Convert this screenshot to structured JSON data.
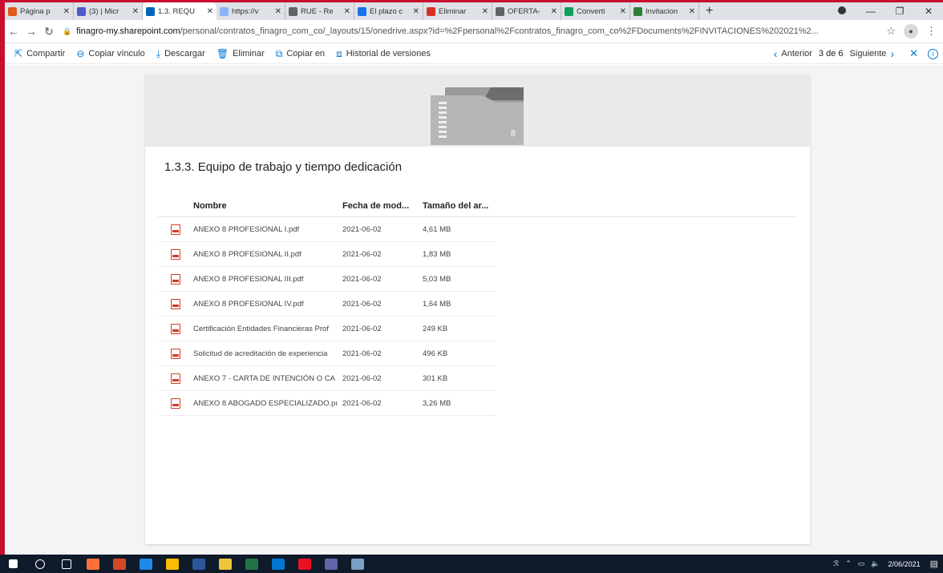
{
  "browser": {
    "tabs": [
      {
        "label": "Página p",
        "color": "#e05a1a",
        "active": false
      },
      {
        "label": "(3) | Micr",
        "color": "#5059c9",
        "active": false
      },
      {
        "label": "1.3. REQU",
        "color": "#0364b8",
        "active": true
      },
      {
        "label": "https://v",
        "color": "#8ab4f8",
        "active": false
      },
      {
        "label": "RUE - Re",
        "color": "#5f6368",
        "active": false
      },
      {
        "label": "El plazo c",
        "color": "#1a73e8",
        "active": false
      },
      {
        "label": "Eliminar",
        "color": "#d93025",
        "active": false
      },
      {
        "label": "OFERTA-",
        "color": "#5f6368",
        "active": false
      },
      {
        "label": "Converti",
        "color": "#0f9d58",
        "active": false
      },
      {
        "label": "Invitacion",
        "color": "#2e7d32",
        "active": false
      }
    ],
    "tab_close": "✕",
    "new_tab": "+",
    "url_domain": "finagro-my.sharepoint.com",
    "url_path": "/personal/contratos_finagro_com_co/_layouts/15/onedrive.aspx?id=%2Fpersonal%2Fcontratos_finagro_com_co%2FDocuments%2FINVITACIONES%202021%2..."
  },
  "commands": {
    "share": "Compartir",
    "copy_link": "Copiar vínculo",
    "download": "Descargar",
    "delete": "Eliminar",
    "copy_to": "Copiar en",
    "version_history": "Historial de versiones",
    "previous": "Anterior",
    "position": "3 de 6",
    "next": "Siguiente"
  },
  "folder": {
    "item_count": "8",
    "title": "1.3.3. Equipo de trabajo y tiempo dedicación"
  },
  "list": {
    "headers": {
      "name": "Nombre",
      "modified": "Fecha de mod...",
      "size": "Tamaño del ar..."
    },
    "rows": [
      {
        "name": "ANEXO 8 PROFESIONAL I.pdf",
        "date": "2021-06-02",
        "size": "4,61 MB"
      },
      {
        "name": "ANEXO 8 PROFESIONAL II.pdf",
        "date": "2021-06-02",
        "size": "1,83 MB"
      },
      {
        "name": "ANEXO 8 PROFESIONAL III.pdf",
        "date": "2021-06-02",
        "size": "5,03 MB"
      },
      {
        "name": "ANEXO 8 PROFESIONAL IV.pdf",
        "date": "2021-06-02",
        "size": "1,64 MB"
      },
      {
        "name": "Certificación Entidades Financieras Prof",
        "date": "2021-06-02",
        "size": "249 KB"
      },
      {
        "name": "Solicitud de acreditación de experiencia",
        "date": "2021-06-02",
        "size": "496 KB"
      },
      {
        "name": "ANEXO 7 - CARTA DE INTENCIÓN O CA",
        "date": "2021-06-02",
        "size": "301 KB"
      },
      {
        "name": "ANEXO 8 ABOGADO ESPECIALIZADO.pı",
        "date": "2021-06-02",
        "size": "3,26 MB"
      }
    ]
  },
  "taskbar": {
    "date": "2/06/2021",
    "apps": [
      {
        "name": "start",
        "color": "#ffffff"
      },
      {
        "name": "search",
        "color": "#ffffff"
      },
      {
        "name": "task-view",
        "color": "#ffffff"
      },
      {
        "name": "firefox",
        "color": "#ff7139"
      },
      {
        "name": "powerpoint",
        "color": "#d24726"
      },
      {
        "name": "edge",
        "color": "#1e88e5"
      },
      {
        "name": "chrome",
        "color": "#fbbc05"
      },
      {
        "name": "word",
        "color": "#2b579a"
      },
      {
        "name": "files",
        "color": "#f0c33c"
      },
      {
        "name": "excel",
        "color": "#217346"
      },
      {
        "name": "outlook",
        "color": "#0078d4"
      },
      {
        "name": "acrobat",
        "color": "#e81123"
      },
      {
        "name": "teams",
        "color": "#6264a7"
      },
      {
        "name": "other",
        "color": "#7aa0c4"
      }
    ]
  }
}
